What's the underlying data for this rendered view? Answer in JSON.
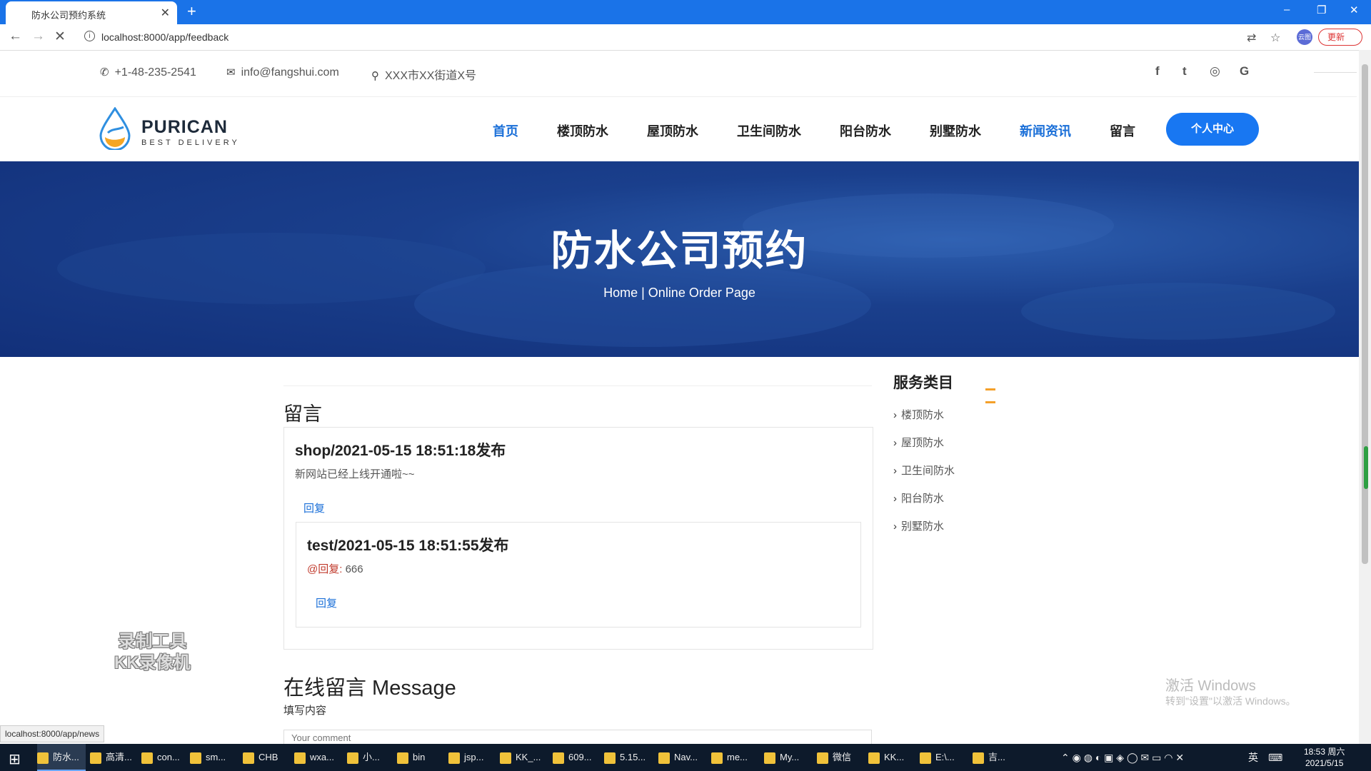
{
  "browser": {
    "tab_title": "防水公司预约系统",
    "tab_close": "✕",
    "new_tab": "+",
    "url": "localhost:8000/app/feedback",
    "update_label": "更新",
    "avatar_label": "云图",
    "status_url": "localhost:8000/app/news"
  },
  "topbar": {
    "phone": "+1-48-235-2541",
    "email": "info@fangshui.com",
    "address": "XXX市XX街道X号",
    "social": [
      "f",
      "t",
      "◎",
      "G"
    ]
  },
  "header": {
    "logo_name": "PURICAN",
    "logo_sub": "BEST DELIVERY",
    "nav": [
      {
        "label": "首页",
        "active": true
      },
      {
        "label": "楼顶防水",
        "active": false
      },
      {
        "label": "屋顶防水",
        "active": false
      },
      {
        "label": "卫生间防水",
        "active": false
      },
      {
        "label": "阳台防水",
        "active": false
      },
      {
        "label": "别墅防水",
        "active": false
      },
      {
        "label": "新闻资讯",
        "active": true
      },
      {
        "label": "留言",
        "active": false
      }
    ],
    "center_button": "个人中心"
  },
  "hero": {
    "title": "防水公司预约",
    "breadcrumb": "Home | Online Order Page"
  },
  "comments": {
    "section_title": "留言",
    "items": [
      {
        "author_line": "shop/2021-05-15 18:51:18发布",
        "content": "新网站已经上线开通啦~~",
        "reply_label": "回复",
        "replies": [
          {
            "author_line": "test/2021-05-15 18:51:55发布",
            "at_label": "@回复:",
            "content": "666",
            "reply_label": "回复"
          }
        ]
      }
    ]
  },
  "message": {
    "title": "在线留言 Message",
    "label": "填写内容",
    "placeholder": "Your comment"
  },
  "sidebar": {
    "title": "服务类目",
    "items": [
      "楼顶防水",
      "屋顶防水",
      "卫生间防水",
      "阳台防水",
      "别墅防水"
    ]
  },
  "watermarks": {
    "kk_line1": "录制工具",
    "kk_line2": "KK录像机",
    "win_line1": "激活 Windows",
    "win_line2": "转到\"设置\"以激活 Windows。"
  },
  "taskbar": {
    "items": [
      "防水...",
      "高清...",
      "con...",
      "sm...",
      "CHB",
      "wxa...",
      "小...",
      "bin",
      "jsp...",
      "KK_...",
      "609...",
      "5.15...",
      "Nav...",
      "me...",
      "My...",
      "微信",
      "KK...",
      "E:\\...",
      "吉..."
    ],
    "tray_lang": "英",
    "time": "18:53 周六",
    "date": "2021/5/15"
  },
  "colors": {
    "brand_blue": "#1877f2",
    "nav_active": "#1a6fd8",
    "hero_bg": "#1a3f8c",
    "accent_orange": "#f4a02a"
  }
}
